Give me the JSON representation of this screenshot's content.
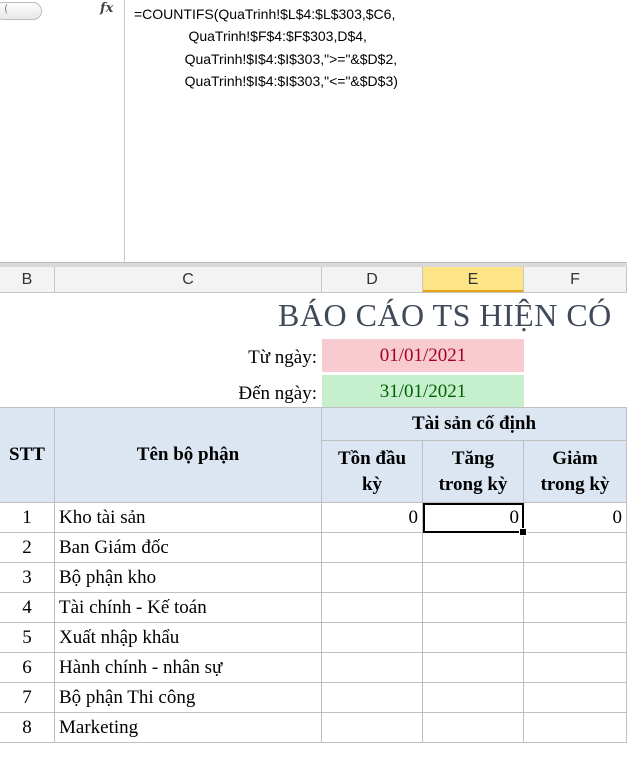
{
  "formula_bar": {
    "fx_label": "fx",
    "formula": "=COUNTIFS(QuaTrinh!$L$4:$L$303,$C6,\n              QuaTrinh!$F$4:$F$303,D$4,\n             QuaTrinh!$I$4:$I$303,\">=\"&$D$2,\n             QuaTrinh!$I$4:$I$303,\"<=\"&$D$3)"
  },
  "columns": [
    "B",
    "C",
    "D",
    "E",
    "F"
  ],
  "active_column": "E",
  "report": {
    "title": "BÁO CÁO TS HIỆN CÓ",
    "from_label": "Từ ngày:",
    "from_date": "01/01/2021",
    "to_label": "Đến ngày:",
    "to_date": "31/01/2021",
    "colors": {
      "from_bg": "#f8cbd0",
      "from_text": "#a50021",
      "to_bg": "#c6efce",
      "to_text": "#006100",
      "header_bg": "#dce6f2"
    }
  },
  "table": {
    "headers": {
      "stt": "STT",
      "dept": "Tên bộ phận",
      "group": "Tài sản cố định",
      "opening": "Tồn đầu kỳ",
      "increase": "Tăng trong kỳ",
      "decrease": "Giảm trong kỳ"
    },
    "rows": [
      {
        "stt": "1",
        "name": "Kho tài sản",
        "opening": "0",
        "increase": "0",
        "decrease": "0"
      },
      {
        "stt": "2",
        "name": "Ban Giám đốc",
        "opening": "",
        "increase": "",
        "decrease": ""
      },
      {
        "stt": "3",
        "name": "Bộ phận kho",
        "opening": "",
        "increase": "",
        "decrease": ""
      },
      {
        "stt": "4",
        "name": "Tài chính - Kế toán",
        "opening": "",
        "increase": "",
        "decrease": ""
      },
      {
        "stt": "5",
        "name": "Xuất nhập khẩu",
        "opening": "",
        "increase": "",
        "decrease": ""
      },
      {
        "stt": "6",
        "name": "Hành chính - nhân sự",
        "opening": "",
        "increase": "",
        "decrease": ""
      },
      {
        "stt": "7",
        "name": "Bộ phận Thi công",
        "opening": "",
        "increase": "",
        "decrease": ""
      },
      {
        "stt": "8",
        "name": "Marketing",
        "opening": "",
        "increase": "",
        "decrease": ""
      }
    ]
  }
}
